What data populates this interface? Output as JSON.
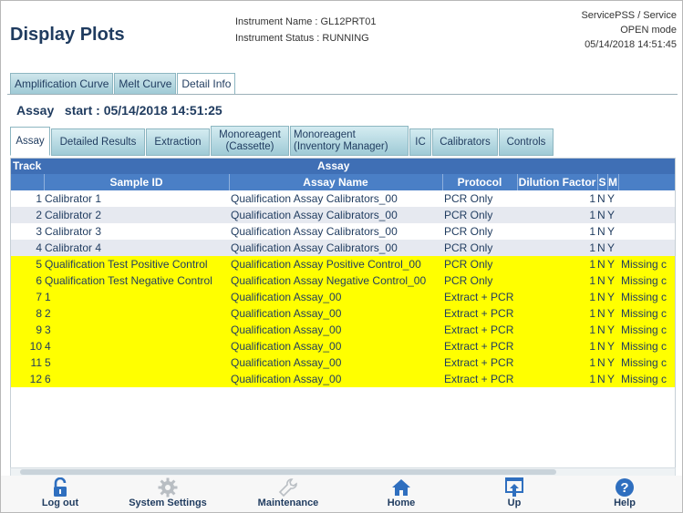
{
  "header": {
    "title": "Display Plots",
    "instrument_name": "Instrument Name : GL12PRT01",
    "instrument_status": "Instrument Status : RUNNING",
    "user": "ServicePSS / Service",
    "mode": "OPEN mode",
    "datetime": "05/14/2018 14:51:45"
  },
  "top_tabs": [
    {
      "label": "Amplification Curve"
    },
    {
      "label": "Melt Curve"
    },
    {
      "label": "Detail Info"
    }
  ],
  "assay_line": "Assay   start : 05/14/2018 14:51:25",
  "sub_tabs": [
    {
      "label": "Assay"
    },
    {
      "label": "Detailed Results"
    },
    {
      "label": "Extraction"
    },
    {
      "label1": "Monoreagent",
      "label2": "(Cassette)"
    },
    {
      "label1": "Monoreagent",
      "label2": "(Inventory Manager)"
    },
    {
      "label": "IC"
    },
    {
      "label": "Calibrators"
    },
    {
      "label": "Controls"
    }
  ],
  "table": {
    "group_track": "Track",
    "group_assay": "Assay",
    "columns": {
      "sample_id": "Sample ID",
      "assay_name": "Assay Name",
      "protocol": "Protocol",
      "dilution": "Dilution Factor",
      "s": "S",
      "m": "M"
    },
    "rows": [
      {
        "track": "1",
        "sample": "Calibrator 1",
        "assay": "Qualification Assay Calibrators_00",
        "protocol": "PCR Only",
        "dil": "1",
        "s": "N",
        "m": "Y",
        "extra": ""
      },
      {
        "track": "2",
        "sample": "Calibrator 2",
        "assay": "Qualification Assay Calibrators_00",
        "protocol": "PCR Only",
        "dil": "1",
        "s": "N",
        "m": "Y",
        "extra": ""
      },
      {
        "track": "3",
        "sample": "Calibrator 3",
        "assay": "Qualification Assay Calibrators_00",
        "protocol": "PCR Only",
        "dil": "1",
        "s": "N",
        "m": "Y",
        "extra": ""
      },
      {
        "track": "4",
        "sample": "Calibrator 4",
        "assay": "Qualification Assay Calibrators_00",
        "protocol": "PCR Only",
        "dil": "1",
        "s": "N",
        "m": "Y",
        "extra": ""
      },
      {
        "track": "5",
        "sample": "Qualification Test Positive Control",
        "assay": "Qualification Assay Positive Control_00",
        "protocol": "PCR Only",
        "dil": "1",
        "s": "N",
        "m": "Y",
        "extra": "Missing c"
      },
      {
        "track": "6",
        "sample": "Qualification Test Negative Control",
        "assay": "Qualification Assay Negative Control_00",
        "protocol": "PCR Only",
        "dil": "1",
        "s": "N",
        "m": "Y",
        "extra": "Missing c"
      },
      {
        "track": "7",
        "sample": "1",
        "assay": "Qualification Assay_00",
        "protocol": "Extract + PCR",
        "dil": "1",
        "s": "N",
        "m": "Y",
        "extra": "Missing c"
      },
      {
        "track": "8",
        "sample": "2",
        "assay": "Qualification Assay_00",
        "protocol": "Extract + PCR",
        "dil": "1",
        "s": "N",
        "m": "Y",
        "extra": "Missing c"
      },
      {
        "track": "9",
        "sample": "3",
        "assay": "Qualification Assay_00",
        "protocol": "Extract + PCR",
        "dil": "1",
        "s": "N",
        "m": "Y",
        "extra": "Missing c"
      },
      {
        "track": "10",
        "sample": "4",
        "assay": "Qualification Assay_00",
        "protocol": "Extract + PCR",
        "dil": "1",
        "s": "N",
        "m": "Y",
        "extra": "Missing c"
      },
      {
        "track": "11",
        "sample": "5",
        "assay": "Qualification Assay_00",
        "protocol": "Extract + PCR",
        "dil": "1",
        "s": "N",
        "m": "Y",
        "extra": "Missing c"
      },
      {
        "track": "12",
        "sample": "6",
        "assay": "Qualification Assay_00",
        "protocol": "Extract + PCR",
        "dil": "1",
        "s": "N",
        "m": "Y",
        "extra": "Missing c"
      }
    ],
    "highlight_color": "#ffff00",
    "header_color": "#4a7fc6"
  },
  "footer": [
    {
      "label": "Log out",
      "icon": "lock-icon"
    },
    {
      "label": "System Settings",
      "icon": "gear-icon"
    },
    {
      "label": "Maintenance",
      "icon": "wrench-icon"
    },
    {
      "label": "Home",
      "icon": "home-icon"
    },
    {
      "label": "Up",
      "icon": "up-arrow-icon"
    },
    {
      "label": "Help",
      "icon": "help-icon"
    }
  ]
}
